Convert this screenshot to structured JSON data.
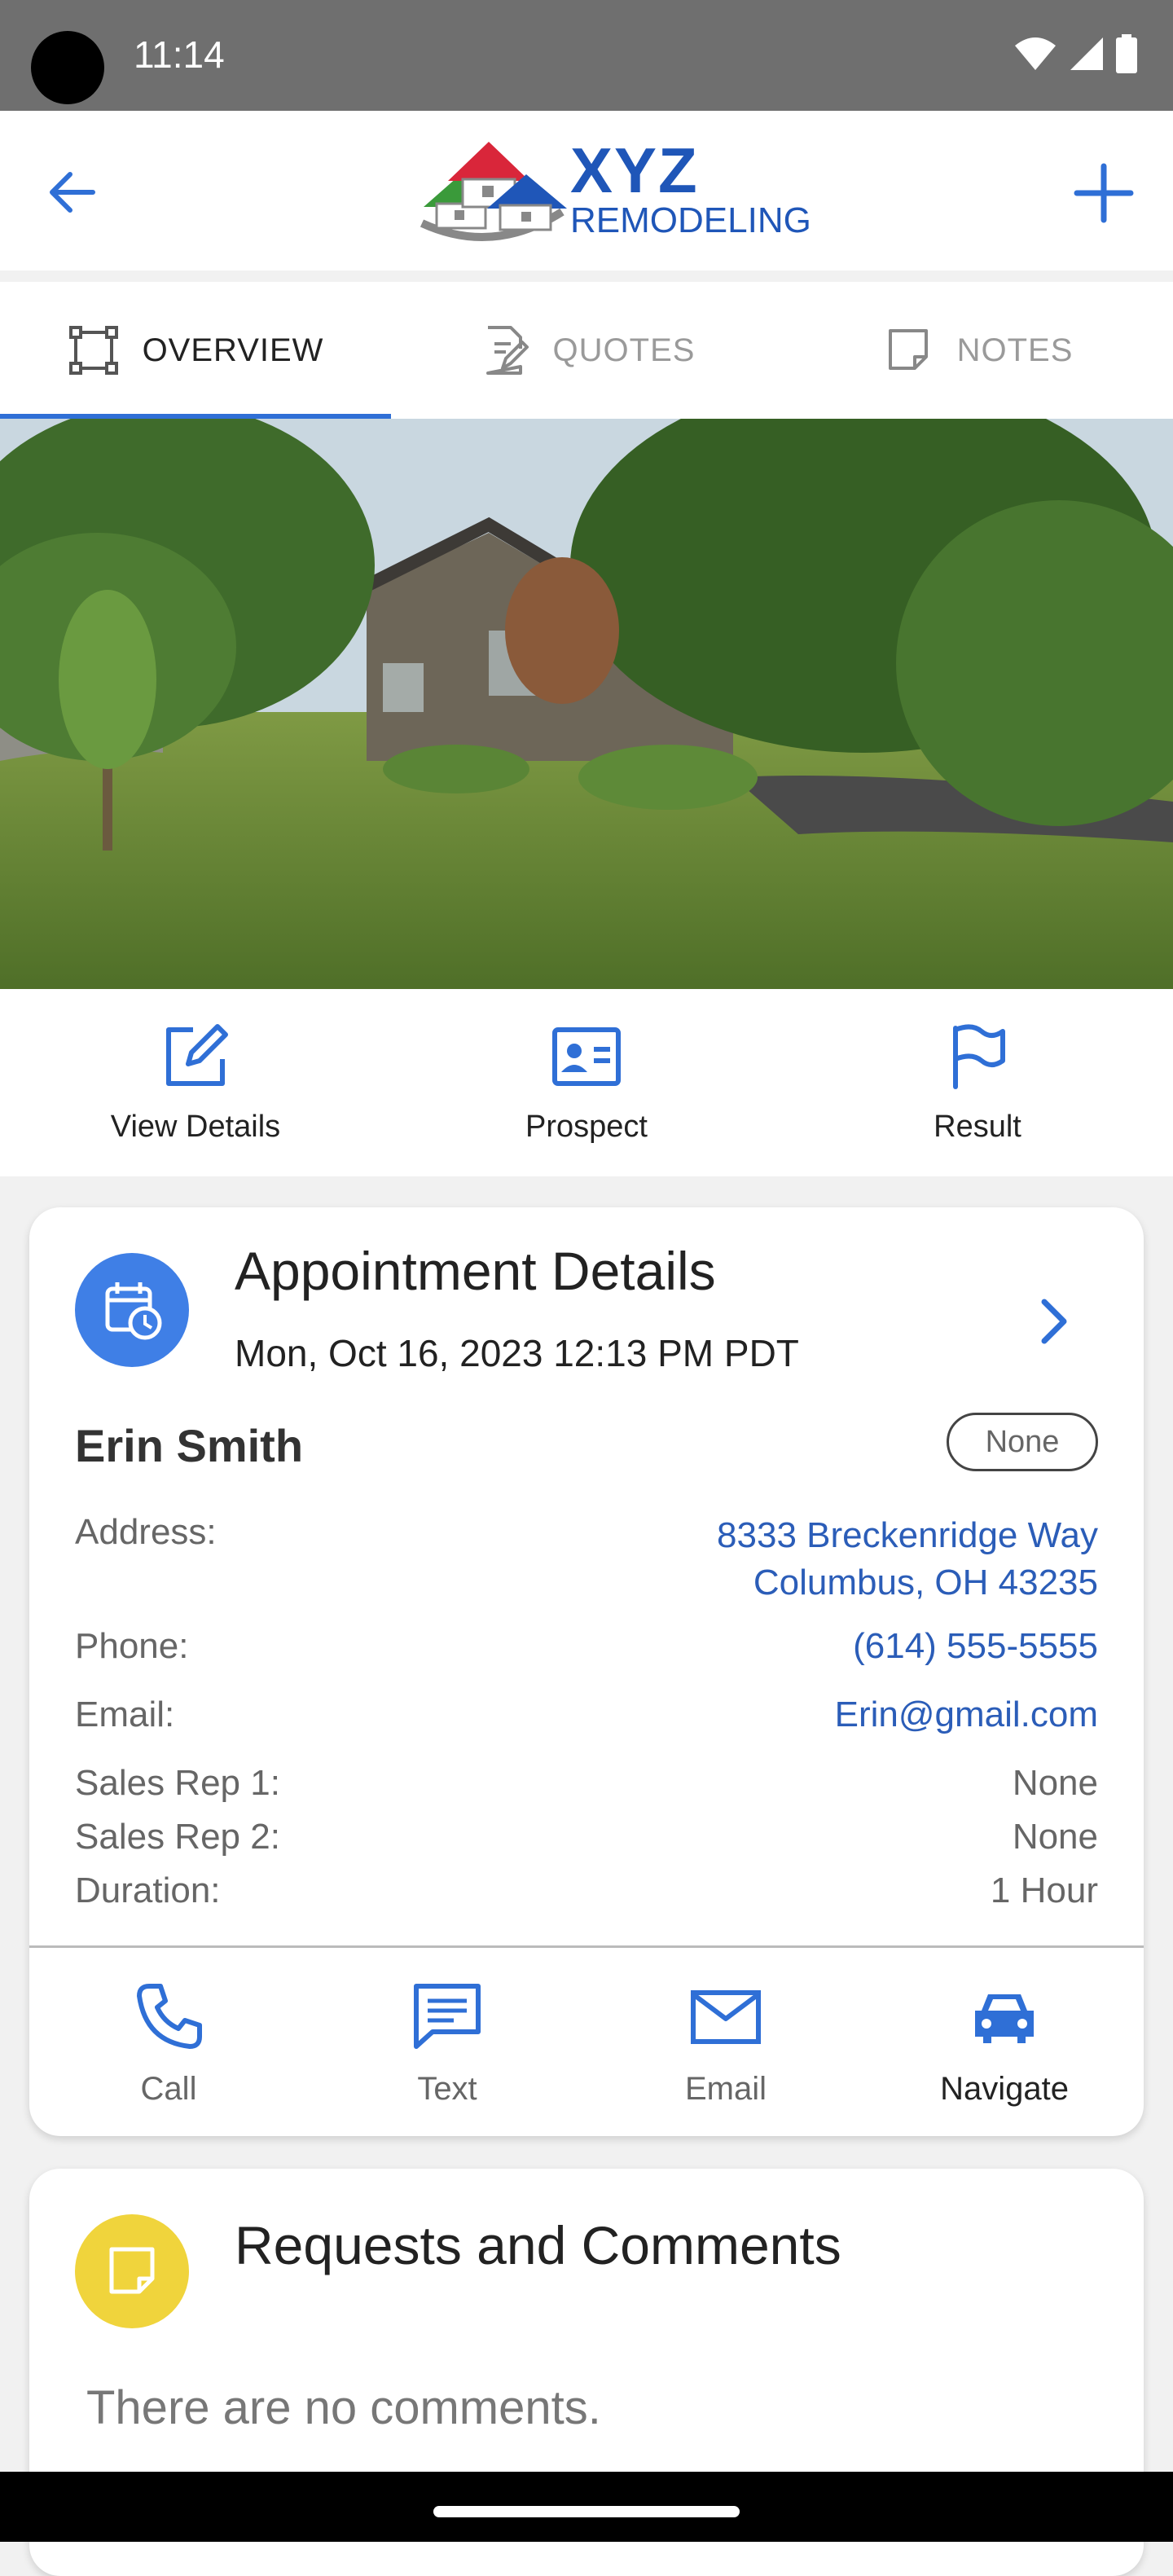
{
  "status_bar": {
    "time": "11:14"
  },
  "app_bar": {
    "logo_top": "XYZ",
    "logo_bottom": "REMODELING"
  },
  "tabs": [
    {
      "label": "OVERVIEW",
      "icon": "crop-frame-icon",
      "active": true
    },
    {
      "label": "QUOTES",
      "icon": "document-edit-icon",
      "active": false
    },
    {
      "label": "NOTES",
      "icon": "note-icon",
      "active": false
    }
  ],
  "quick_actions": [
    {
      "label": "View Details",
      "icon": "edit-icon"
    },
    {
      "label": "Prospect",
      "icon": "id-card-icon"
    },
    {
      "label": "Result",
      "icon": "flag-icon"
    }
  ],
  "appointment": {
    "title": "Appointment Details",
    "datetime": "Mon, Oct 16, 2023 12:13 PM PDT",
    "name": "Erin Smith",
    "status": "None",
    "address_label": "Address:",
    "address_line1": "8333 Breckenridge Way",
    "address_line2": "Columbus, OH 43235",
    "phone_label": "Phone:",
    "phone": "(614) 555-5555",
    "email_label": "Email:",
    "email": "Erin@gmail.com",
    "rep1_label": "Sales Rep 1:",
    "rep1": "None",
    "rep2_label": "Sales Rep 2:",
    "rep2": "None",
    "duration_label": "Duration:",
    "duration": "1 Hour"
  },
  "contact_actions": [
    {
      "label": "Call",
      "icon": "phone-icon"
    },
    {
      "label": "Text",
      "icon": "message-icon"
    },
    {
      "label": "Email",
      "icon": "mail-icon"
    },
    {
      "label": "Navigate",
      "icon": "car-icon"
    }
  ],
  "requests": {
    "title": "Requests and Comments",
    "empty_text": "There are no comments."
  },
  "colors": {
    "accent": "#2f6fd6",
    "link": "#2b5db8",
    "appointment_icon_bg": "#3f7fe6",
    "requests_icon_bg": "#f0d43c"
  }
}
